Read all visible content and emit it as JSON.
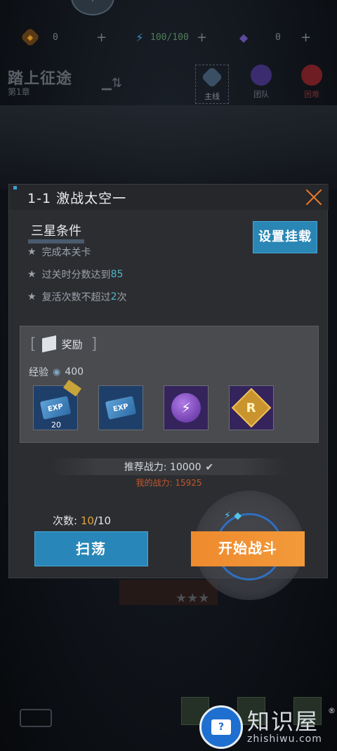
{
  "resources": {
    "coin": {
      "icon": "coin-icon",
      "value": "0",
      "plus": "+"
    },
    "energy": {
      "icon": "lightning-icon",
      "value": "100/100",
      "plus": "+"
    },
    "gem": {
      "icon": "gem-icon",
      "value": "0",
      "plus": "+"
    }
  },
  "chapter": {
    "title": "踏上征途",
    "subtitle": "第1章"
  },
  "modes": [
    {
      "label": "主线",
      "icon": "main-line-icon"
    },
    {
      "label": "团队",
      "icon": "team-icon"
    },
    {
      "label": "困难",
      "icon": "hard-icon"
    }
  ],
  "dialog": {
    "title": "1-1   激战太空一",
    "three_star_title": "三星条件",
    "conditions": [
      {
        "prefix": "完成本关卡",
        "highlight": "",
        "suffix": ""
      },
      {
        "prefix": "过关时分数达到",
        "highlight": "85",
        "suffix": ""
      },
      {
        "prefix": "复活次数不超过",
        "highlight": "2",
        "suffix": "次"
      }
    ],
    "auto_button": "设置挂载",
    "reward": {
      "title": "奖励",
      "exp_label": "经验",
      "exp_value": "400",
      "items": [
        {
          "name": "exp-card",
          "icon": "exp-card-icon",
          "label": "EXP",
          "count": "20",
          "first": true
        },
        {
          "name": "exp-card",
          "icon": "exp-card-icon",
          "label": "EXP",
          "count": "",
          "first": false
        },
        {
          "name": "energy-orb",
          "icon": "lightning-icon",
          "count": ""
        },
        {
          "name": "r-coin",
          "icon": "r-coin-icon",
          "label": "R",
          "count": ""
        }
      ]
    },
    "recommended_power": "推荐战力: 10000",
    "my_power": "我的战力: 15925",
    "attempts_label": "次数: ",
    "attempts_current": "10",
    "attempts_total": "/10",
    "sweep_button": "扫荡",
    "start_button": "开始战斗"
  },
  "watermark": {
    "text": "知识屋",
    "reg": "®",
    "url": "zhishiwu.com",
    "badge": "?"
  },
  "colors": {
    "accent_blue": "#2986b8",
    "accent_orange": "#ee8a2e",
    "highlight_cyan": "#4fb6c9",
    "my_power_red": "#c3582a"
  }
}
